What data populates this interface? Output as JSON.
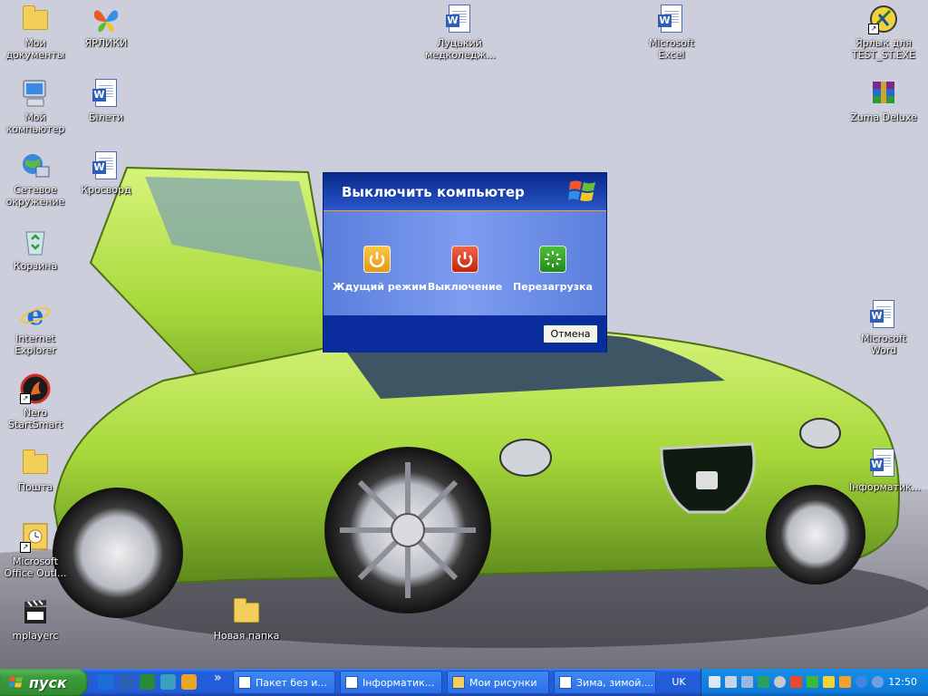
{
  "desktop_icons_left": [
    {
      "name": "my-documents",
      "label": "Мои документы",
      "icon": "folder-documents-icon"
    },
    {
      "name": "shortcuts",
      "label": "ЯРЛИКИ",
      "icon": "butterfly-icon"
    },
    {
      "name": "my-computer",
      "label": "Мой компьютер",
      "icon": "computer-icon"
    },
    {
      "name": "tickets",
      "label": "Білети",
      "icon": "word-document-icon"
    },
    {
      "name": "network",
      "label": "Сетевое окружение",
      "icon": "network-icon"
    },
    {
      "name": "crossword",
      "label": "Кросворд",
      "icon": "word-document-icon"
    },
    {
      "name": "recycle-bin",
      "label": "Корзина",
      "icon": "recycle-bin-icon"
    },
    {
      "name": "internet-explorer",
      "label": "Internet Explorer",
      "icon": "internet-explorer-icon"
    },
    {
      "name": "nero",
      "label": "Nero StartSmart",
      "icon": "nero-icon"
    },
    {
      "name": "mail-folder",
      "label": "Пошта",
      "icon": "folder-icon"
    },
    {
      "name": "outlook",
      "label": "Microsoft Office Outl...",
      "icon": "outlook-icon"
    },
    {
      "name": "mplayerc",
      "label": "mplayerc",
      "icon": "clapperboard-icon"
    },
    {
      "name": "new-folder",
      "label": "Новая папка",
      "icon": "folder-icon"
    }
  ],
  "desktop_icons_top": [
    {
      "name": "lutsk-college",
      "label": "Луцький медколедж...",
      "icon": "word-document-icon"
    },
    {
      "name": "microsoft-excel",
      "label": "Microsoft Excel",
      "icon": "word-document-icon"
    },
    {
      "name": "test-shortcut",
      "label": "Ярлык для TEST_ST.EXE",
      "icon": "test-app-icon"
    },
    {
      "name": "zuma",
      "label": "Zuma Deluxe",
      "icon": "winrar-icon"
    },
    {
      "name": "microsoft-word",
      "label": "Microsoft Word",
      "icon": "word-document-icon"
    },
    {
      "name": "informatics",
      "label": "Інформатик...",
      "icon": "word-document-icon"
    }
  ],
  "dialog": {
    "title": "Выключить компьютер",
    "standby_label": "Ждущий режим",
    "shutdown_label": "Выключение",
    "restart_label": "Перезагрузка",
    "cancel_label": "Отмена"
  },
  "taskbar": {
    "start_label": "пуск",
    "more_label": "»",
    "tasks": [
      {
        "label": "Пакет без и...",
        "icon": "package-icon"
      },
      {
        "label": "Інформатик...",
        "icon": "word-icon"
      },
      {
        "label": "Мои рисунки",
        "icon": "folder-icon"
      },
      {
        "label": "Зима, зимой....",
        "icon": "word-icon"
      }
    ],
    "language": "UK",
    "clock": "12:50"
  },
  "colors": {
    "taskbar_blue": "#245edb",
    "start_green": "#3c9c3c",
    "dialog_blue": "#5a7edc",
    "car_green": "#a6d83a",
    "wallpaper": "#cdcedb"
  }
}
